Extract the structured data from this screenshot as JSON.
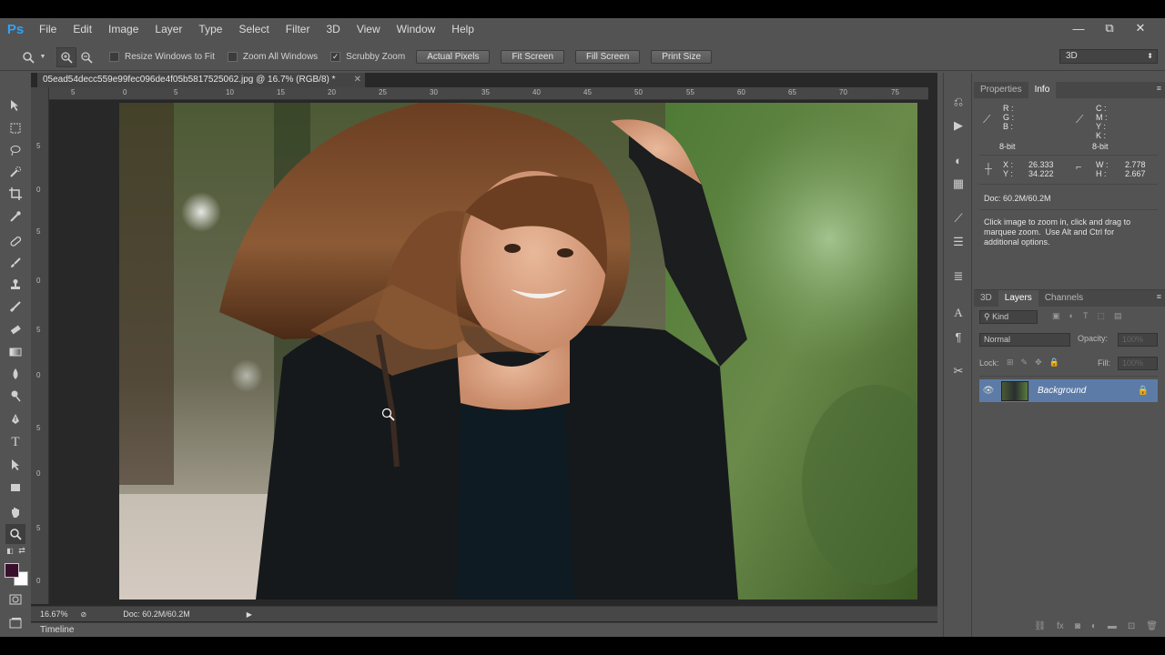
{
  "app": {
    "logo": "Ps"
  },
  "menu": [
    "File",
    "Edit",
    "Image",
    "Layer",
    "Type",
    "Select",
    "Filter",
    "3D",
    "View",
    "Window",
    "Help"
  ],
  "window_controls": {
    "minimize": "—",
    "restore": "⧉",
    "close": "✕"
  },
  "options": {
    "checks": [
      {
        "label": "Resize Windows to Fit",
        "checked": false
      },
      {
        "label": "Zoom All Windows",
        "checked": false
      },
      {
        "label": "Scrubby Zoom",
        "checked": true
      }
    ],
    "buttons": [
      "Actual Pixels",
      "Fit Screen",
      "Fill Screen",
      "Print Size"
    ],
    "workspace": "3D"
  },
  "document": {
    "tab_title": "05ead54decc559e99fec096de4f05b5817525062.jpg @ 16.7% (RGB/8) *",
    "ruler_h": [
      "5",
      "0",
      "5",
      "10",
      "15",
      "20",
      "25",
      "30",
      "35",
      "40",
      "45",
      "50",
      "55",
      "60",
      "65",
      "70",
      "75"
    ],
    "ruler_v": [
      "5",
      "0",
      "5",
      "0",
      "5",
      "0",
      "5",
      "0",
      "5",
      "0",
      "5",
      "0",
      "5"
    ]
  },
  "status": {
    "zoom": "16.67%",
    "doc": "Doc: 60.2M/60.2M"
  },
  "timeline": {
    "label": "Timeline"
  },
  "info_panel": {
    "tabs": [
      "Properties",
      "Info"
    ],
    "rgb_labels": "R :\nG :\nB :",
    "rgb_bit": "8-bit",
    "cmyk_labels": "C :\nM :\nY :\nK :",
    "cmyk_bit": "8-bit",
    "xy_labels": "X :\nY :",
    "xy_values": "26.333\n34.222",
    "wh_labels": "W :\nH :",
    "wh_values": "2.778\n2.667",
    "doc": "Doc: 60.2M/60.2M",
    "hint": "Click image to zoom in, click and drag to\nmarquee zoom.  Use Alt and Ctrl for\nadditional options."
  },
  "layers_panel": {
    "tabs": [
      "3D",
      "Layers",
      "Channels"
    ],
    "kind": "Kind",
    "blend": "Normal",
    "opacity_label": "Opacity:",
    "opacity_value": "100%",
    "lock_label": "Lock:",
    "fill_label": "Fill:",
    "fill_value": "100%",
    "layers": [
      {
        "name": "Background",
        "visible": true,
        "locked": true
      }
    ]
  },
  "colors": {
    "foreground": "#3a0f2e",
    "background": "#ffffff",
    "accent": "#2fa3f5",
    "layer_selected": "#5c7ba7"
  }
}
